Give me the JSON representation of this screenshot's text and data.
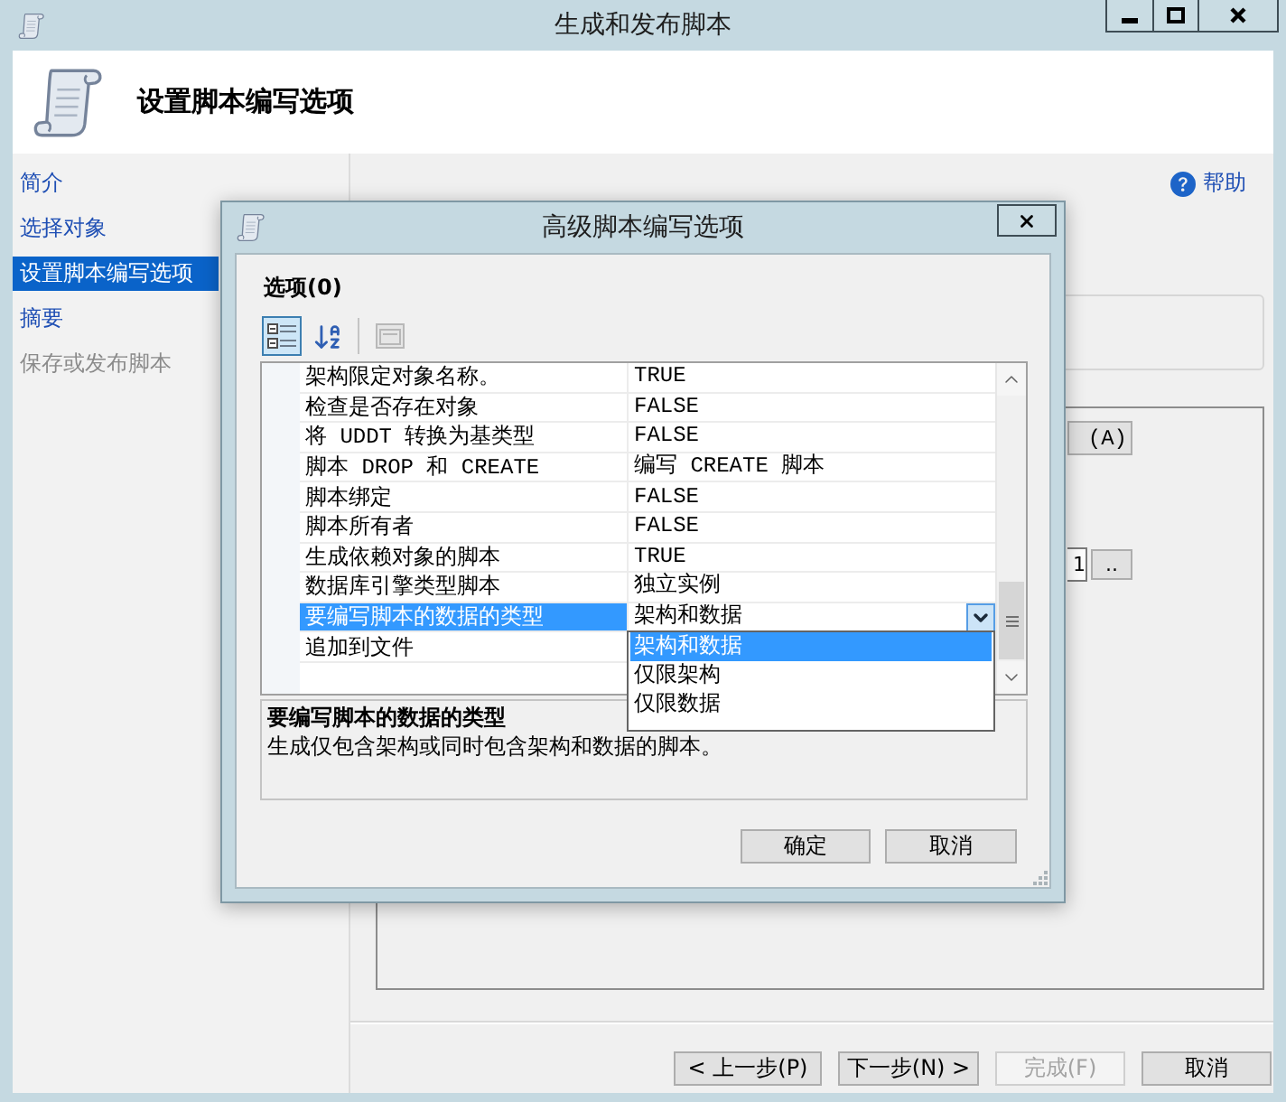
{
  "window": {
    "title": "生成和发布脚本"
  },
  "header": {
    "title": "设置脚本编写选项"
  },
  "sidebar": {
    "items": [
      {
        "label": "简介",
        "selected": false,
        "disabled": false
      },
      {
        "label": "选择对象",
        "selected": false,
        "disabled": false
      },
      {
        "label": "设置脚本编写选项",
        "selected": true,
        "disabled": false
      },
      {
        "label": "摘要",
        "selected": false,
        "disabled": false
      },
      {
        "label": "保存或发布脚本",
        "selected": false,
        "disabled": true
      }
    ]
  },
  "help": {
    "label": "帮助"
  },
  "page": {
    "button_label": "(A)",
    "field_value": "1",
    "browse_label": ".."
  },
  "wizard_buttons": [
    {
      "label": "< 上一步(P)",
      "disabled": false
    },
    {
      "label": "下一步(N) >",
      "disabled": false
    },
    {
      "label": "完成(F)",
      "disabled": true
    },
    {
      "label": "取消",
      "disabled": false
    }
  ],
  "dialog": {
    "title": "高级脚本编写选项",
    "heading": "选项(0)",
    "toolbar": [
      {
        "kind": "categorized",
        "selected": true,
        "disabled": false
      },
      {
        "kind": "alphabetical",
        "selected": false,
        "disabled": false
      },
      {
        "kind": "property_pages",
        "selected": false,
        "disabled": true
      }
    ],
    "properties": [
      {
        "name": "架构限定对象名称。",
        "value": "TRUE",
        "selected": false
      },
      {
        "name": "检查是否存在对象",
        "value": "FALSE",
        "selected": false
      },
      {
        "name": "将 UDDT 转换为基类型",
        "value": "FALSE",
        "selected": false
      },
      {
        "name": "脚本 DROP 和 CREATE",
        "value": "编写 CREATE 脚本",
        "selected": false
      },
      {
        "name": "脚本绑定",
        "value": "FALSE",
        "selected": false
      },
      {
        "name": "脚本所有者",
        "value": "FALSE",
        "selected": false
      },
      {
        "name": "生成依赖对象的脚本",
        "value": "TRUE",
        "selected": false
      },
      {
        "name": "数据库引擎类型脚本",
        "value": "独立实例",
        "selected": false
      },
      {
        "name": "要编写脚本的数据的类型",
        "value": "架构和数据",
        "selected": true,
        "dropdown": {
          "expanded": true,
          "options": [
            {
              "label": "架构和数据",
              "selected": true
            },
            {
              "label": "仅限架构",
              "selected": false
            },
            {
              "label": "仅限数据",
              "selected": false
            }
          ]
        }
      },
      {
        "name": "追加到文件",
        "selected": false
      }
    ],
    "description": {
      "title": "要编写脚本的数据的类型",
      "text": "生成仅包含架构或同时包含架构和数据的脚本。"
    },
    "buttons": [
      "确定",
      "取消"
    ]
  }
}
